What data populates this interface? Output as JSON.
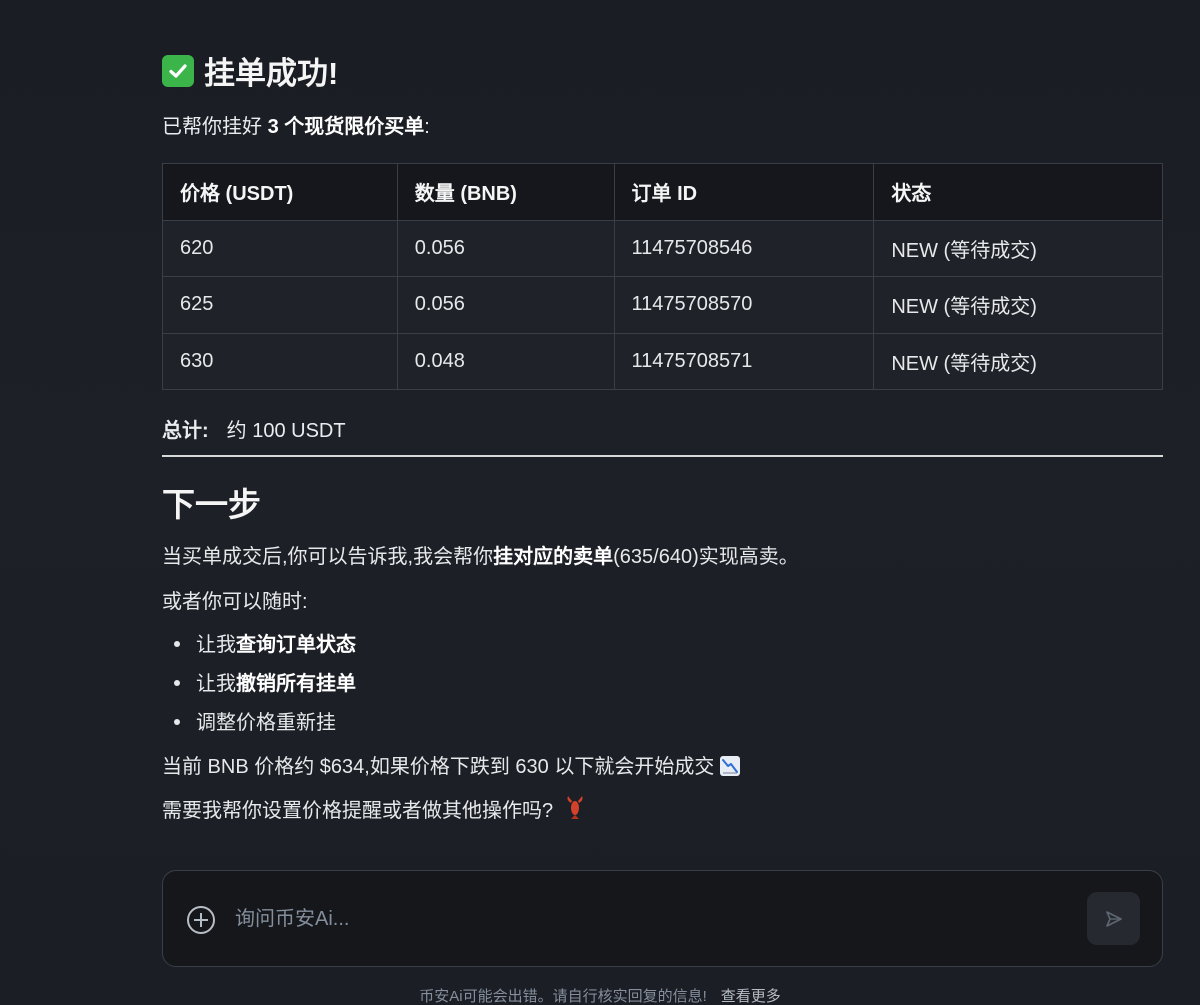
{
  "message": {
    "title": "挂单成功!",
    "intro_prefix": "已帮你挂好 ",
    "intro_bold": "3 个现货限价买单",
    "intro_suffix": ":",
    "table": {
      "headers": [
        "价格 (USDT)",
        "数量 (BNB)",
        "订单 ID",
        "状态"
      ],
      "rows": [
        [
          "620",
          "0.056",
          "11475708546",
          "NEW (等待成交)"
        ],
        [
          "625",
          "0.056",
          "11475708570",
          "NEW (等待成交)"
        ],
        [
          "630",
          "0.048",
          "11475708571",
          "NEW (等待成交)"
        ]
      ]
    },
    "total_label": "总计:",
    "total_value": "约 100 USDT",
    "next_heading": "下一步",
    "next_p1_prefix": "当买单成交后,你可以告诉我,我会帮你",
    "next_p1_bold": "挂对应的卖单",
    "next_p1_suffix": "(635/640)实现高卖。",
    "next_p2": "或者你可以随时:",
    "bullets": [
      {
        "prefix": "让我",
        "bold": "查询订单状态"
      },
      {
        "prefix": "让我",
        "bold": "撤销所有挂单"
      },
      {
        "prefix": "调整价格重新挂",
        "bold": ""
      }
    ],
    "price_note": "当前 BNB 价格约 $634,如果价格下跌到 630 以下就会开始成交",
    "closing": "需要我帮你设置价格提醒或者做其他操作吗?"
  },
  "composer": {
    "placeholder": "询问币安Ai...",
    "value": ""
  },
  "footer": {
    "disclaimer": "币安Ai可能会出错。请自行核实回复的信息!",
    "more_link": "查看更多"
  },
  "icons": {
    "title": "check-icon",
    "price_note": "chart-decreasing-icon",
    "closing": "lobster-icon",
    "composer_add": "plus-circle-icon",
    "send": "send-icon"
  },
  "colors": {
    "background": "#1b1e25",
    "success": "#3bb54a",
    "text": "#eaecef",
    "muted": "#848e9c"
  }
}
